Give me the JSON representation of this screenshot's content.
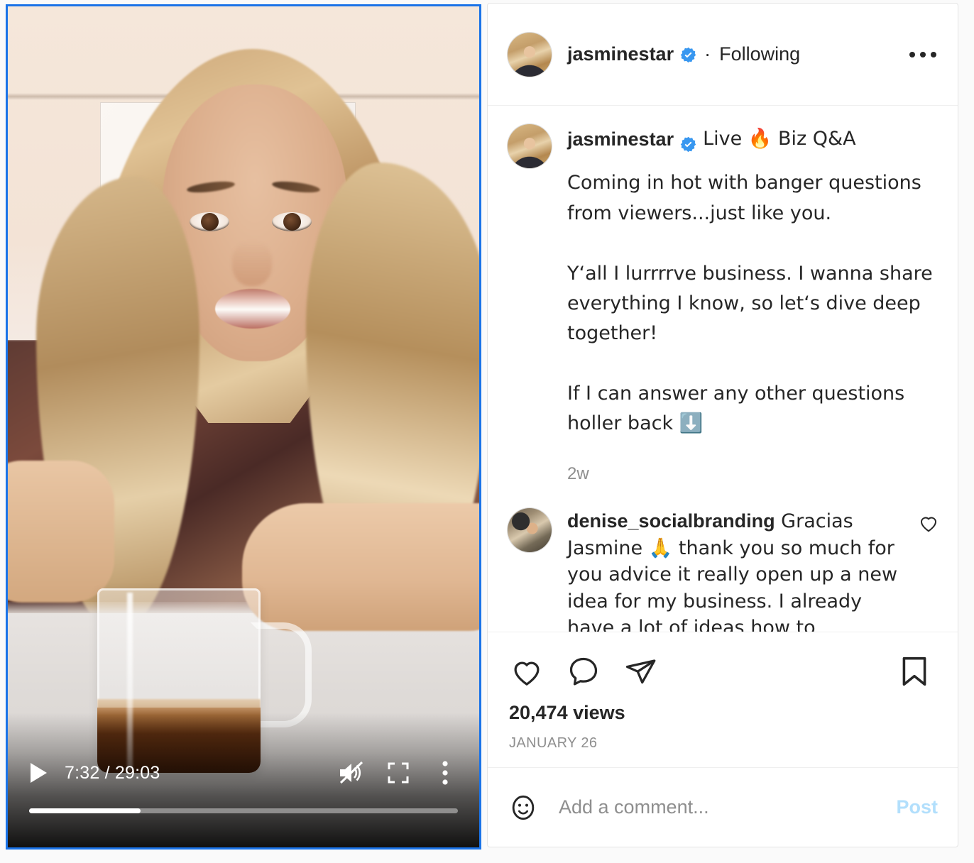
{
  "video": {
    "current_time": "7:32",
    "duration": "29:03",
    "time_display": "7:32 / 29:03",
    "progress_percent": 26,
    "muted": true,
    "playing": false,
    "controls": {
      "play_label": "play-button",
      "mute_label": "unmute-button",
      "fullscreen_label": "fullscreen-button",
      "options_label": "more-options-button"
    },
    "focus_border_color": "#1a73e8"
  },
  "header": {
    "username": "jasminestar",
    "verified": true,
    "separator": "·",
    "follow_state": "Following",
    "more_label": "More options"
  },
  "post": {
    "username": "jasminestar",
    "verified": true,
    "title_suffix": "Live 🔥 Biz Q&A",
    "caption": "Coming in hot with banger questions from viewers...just like you.\n\nY‘all I lurrrrve business. I wanna share everything I know, so let‘s dive deep together!\n\nIf I can answer any other questions holler back ⬇️",
    "timestamp": "2w"
  },
  "comments": [
    {
      "username": "denise_socialbranding",
      "text": " Gracias Jasmine 🙏 thank you so much for you advice it really open up a new idea for my business. I already have a lot of ideas how to implement you advice"
    }
  ],
  "actions": {
    "like_label": "Like",
    "comment_label": "Comment",
    "share_label": "Share",
    "save_label": "Save",
    "views": "20,474 views",
    "date": "JANUARY 26"
  },
  "compose": {
    "emoji_label": "Emoji picker",
    "placeholder": "Add a comment...",
    "value": "",
    "post_label": "Post",
    "post_color": "#b2dffc"
  },
  "colors": {
    "verified_blue": "#3897f0",
    "text_primary": "#262626",
    "text_secondary": "#8e8e8e",
    "divider": "#efefef",
    "page_bg": "#fafafa"
  }
}
